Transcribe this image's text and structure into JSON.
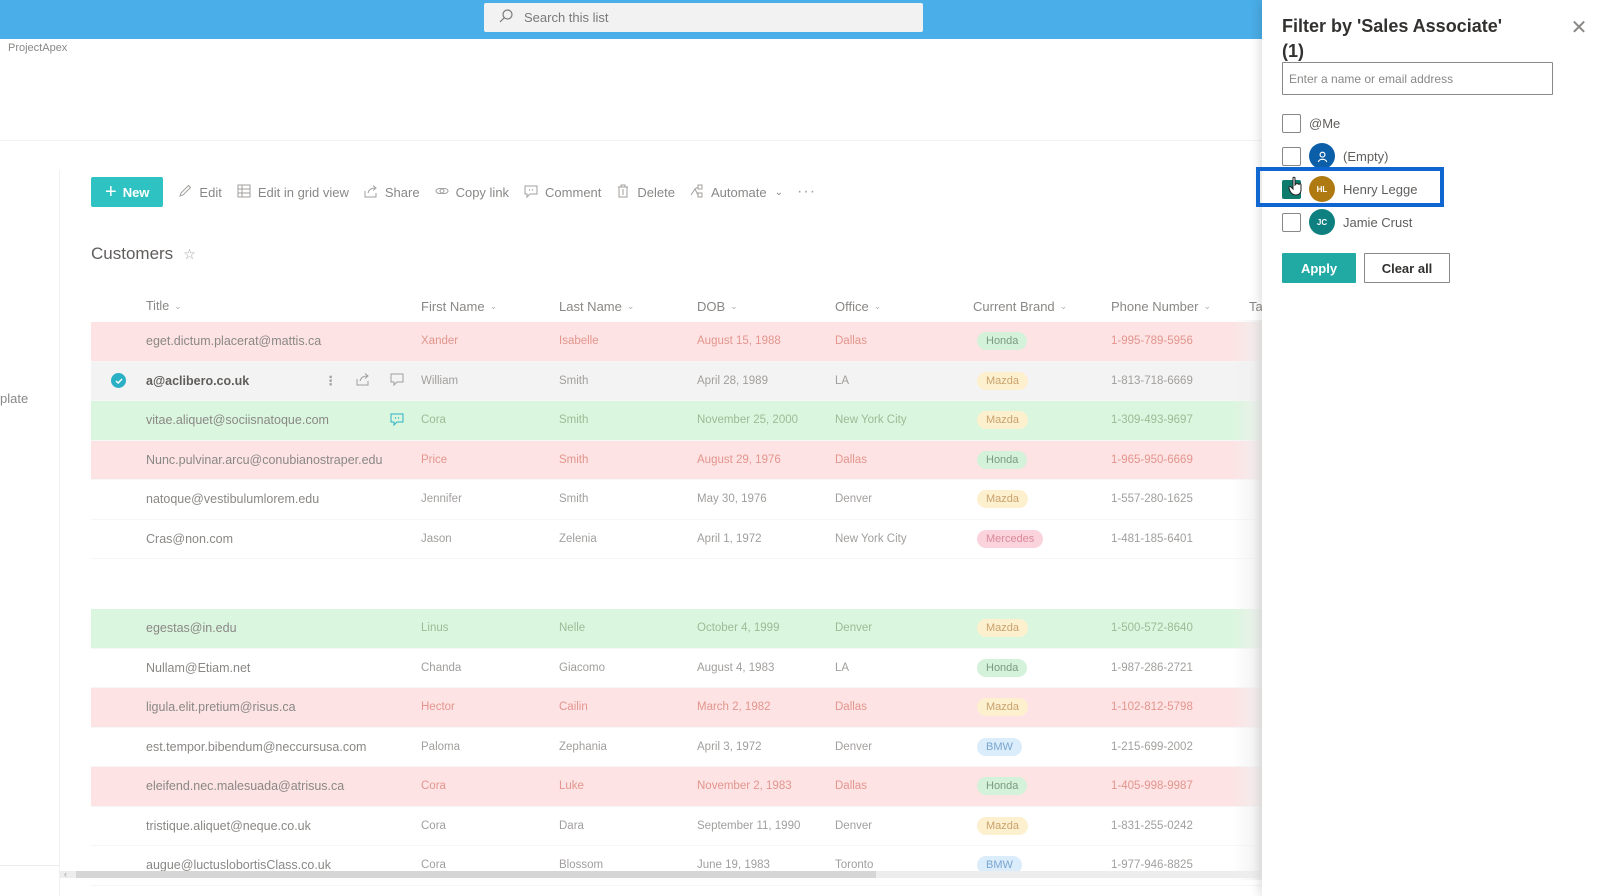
{
  "topbar": {
    "search_placeholder": "Search this list",
    "search_icon": "search-icon"
  },
  "site": {
    "name": "ProjectApex"
  },
  "left_rail": {
    "partial_label": "plate"
  },
  "commandbar": {
    "new_label": "New",
    "items": [
      {
        "label": "Edit",
        "icon": "pencil-icon"
      },
      {
        "label": "Edit in grid view",
        "icon": "grid-icon"
      },
      {
        "label": "Share",
        "icon": "share-icon"
      },
      {
        "label": "Copy link",
        "icon": "link-icon"
      },
      {
        "label": "Comment",
        "icon": "comment-icon"
      },
      {
        "label": "Delete",
        "icon": "trash-icon"
      },
      {
        "label": "Automate",
        "icon": "flow-icon",
        "has_dropdown": true
      }
    ],
    "more_label": "···"
  },
  "list": {
    "title": "Customers",
    "favorite_icon": "star-icon",
    "columns": [
      "Title",
      "First Name",
      "Last Name",
      "DOB",
      "Office",
      "Current Brand",
      "Phone Number",
      "Ta"
    ],
    "rows": [
      {
        "title": "eget.dictum.placerat@mattis.ca",
        "first": "Xander",
        "last": "Isabelle",
        "dob": "August 15, 1988",
        "office": "Dallas",
        "brand": "Honda",
        "phone": "1-995-789-5956",
        "tone": "red"
      },
      {
        "title": "a@aclibero.co.uk",
        "first": "William",
        "last": "Smith",
        "dob": "April 28, 1989",
        "office": "LA",
        "brand": "Mazda",
        "phone": "1-813-718-6669",
        "tone": "gray",
        "selected": true
      },
      {
        "title": "vitae.aliquet@sociisnatoque.com",
        "first": "Cora",
        "last": "Smith",
        "dob": "November 25, 2000",
        "office": "New York City",
        "brand": "Mazda",
        "phone": "1-309-493-9697",
        "tone": "green",
        "has_comment": true
      },
      {
        "title": "Nunc.pulvinar.arcu@conubianostraper.edu",
        "first": "Price",
        "last": "Smith",
        "dob": "August 29, 1976",
        "office": "Dallas",
        "brand": "Honda",
        "phone": "1-965-950-6669",
        "tone": "red"
      },
      {
        "title": "natoque@vestibulumlorem.edu",
        "first": "Jennifer",
        "last": "Smith",
        "dob": "May 30, 1976",
        "office": "Denver",
        "brand": "Mazda",
        "phone": "1-557-280-1625",
        "tone": "none"
      },
      {
        "title": "Cras@non.com",
        "first": "Jason",
        "last": "Zelenia",
        "dob": "April 1, 1972",
        "office": "New York City",
        "brand": "Mercedes",
        "phone": "1-481-185-6401",
        "tone": "none"
      },
      {
        "spacer": true
      },
      {
        "title": "egestas@in.edu",
        "first": "Linus",
        "last": "Nelle",
        "dob": "October 4, 1999",
        "office": "Denver",
        "brand": "Mazda",
        "phone": "1-500-572-8640",
        "tone": "green"
      },
      {
        "title": "Nullam@Etiam.net",
        "first": "Chanda",
        "last": "Giacomo",
        "dob": "August 4, 1983",
        "office": "LA",
        "brand": "Honda",
        "phone": "1-987-286-2721",
        "tone": "none"
      },
      {
        "title": "ligula.elit.pretium@risus.ca",
        "first": "Hector",
        "last": "Cailin",
        "dob": "March 2, 1982",
        "office": "Dallas",
        "brand": "Mazda",
        "phone": "1-102-812-5798",
        "tone": "red"
      },
      {
        "title": "est.tempor.bibendum@neccursusa.com",
        "first": "Paloma",
        "last": "Zephania",
        "dob": "April 3, 1972",
        "office": "Denver",
        "brand": "BMW",
        "phone": "1-215-699-2002",
        "tone": "none"
      },
      {
        "title": "eleifend.nec.malesuada@atrisus.ca",
        "first": "Cora",
        "last": "Luke",
        "dob": "November 2, 1983",
        "office": "Dallas",
        "brand": "Honda",
        "phone": "1-405-998-9987",
        "tone": "red"
      },
      {
        "title": "tristique.aliquet@neque.co.uk",
        "first": "Cora",
        "last": "Dara",
        "dob": "September 11, 1990",
        "office": "Denver",
        "brand": "Mazda",
        "phone": "1-831-255-0242",
        "tone": "none"
      },
      {
        "title": "augue@luctuslobortisClass.co.uk",
        "first": "Cora",
        "last": "Blossom",
        "dob": "June 19, 1983",
        "office": "Toronto",
        "brand": "BMW",
        "phone": "1-977-946-8825",
        "tone": "none"
      }
    ]
  },
  "filter_panel": {
    "title": "Filter by 'Sales Associate' (1)",
    "close_icon": "close-icon",
    "input_placeholder": "Enter a name or email address",
    "options": [
      {
        "label": "@Me",
        "checked": false,
        "avatar": null
      },
      {
        "label": "(Empty)",
        "checked": false,
        "avatar": {
          "initials": "",
          "color": "#0b5ea8",
          "icon": "person-icon"
        }
      },
      {
        "label": "Henry Legge",
        "checked": true,
        "avatar": {
          "initials": "HL",
          "color": "#b07a12"
        }
      },
      {
        "label": "Jamie Crust",
        "checked": false,
        "avatar": {
          "initials": "JC",
          "color": "#0f8080"
        }
      }
    ],
    "apply_label": "Apply",
    "clear_label": "Clear all"
  }
}
